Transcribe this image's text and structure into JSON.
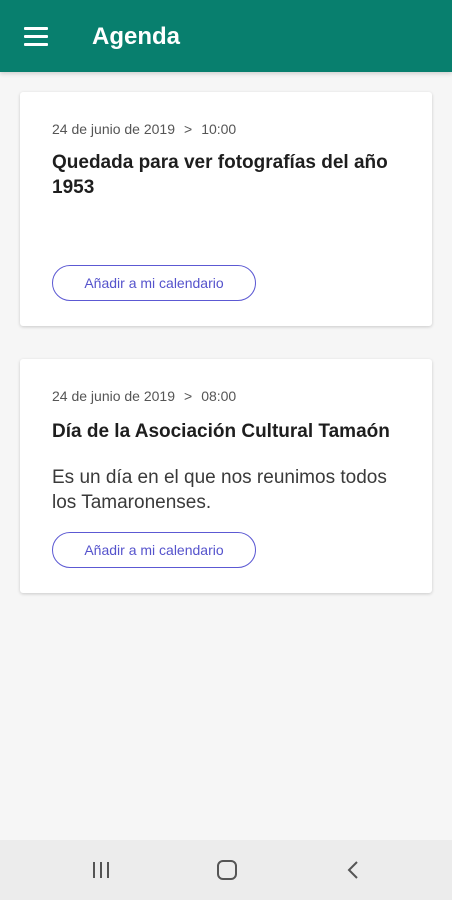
{
  "app_bar": {
    "title": "Agenda",
    "menu_icon": "hamburger-menu-icon",
    "color": "#087f6e"
  },
  "events": [
    {
      "date": "24 de junio de 2019",
      "separator": ">",
      "time": "10:00",
      "title": "Quedada para ver fotografías del año 1953",
      "description": "",
      "button_label": "Añadir a mi calendario"
    },
    {
      "date": "24 de junio de 2019",
      "separator": ">",
      "time": "08:00",
      "title": "Día de la Asociación Cultural Tamaón",
      "description": "Es un día en el que nos reunimos todos los Tamaronenses.",
      "button_label": "Añadir a mi calendario"
    }
  ],
  "nav_bar": {
    "recents_icon": "recent-apps-icon",
    "home_icon": "home-icon",
    "back_icon": "back-icon"
  },
  "colors": {
    "accent": "#5c59d3",
    "background": "#f6f6f6"
  }
}
